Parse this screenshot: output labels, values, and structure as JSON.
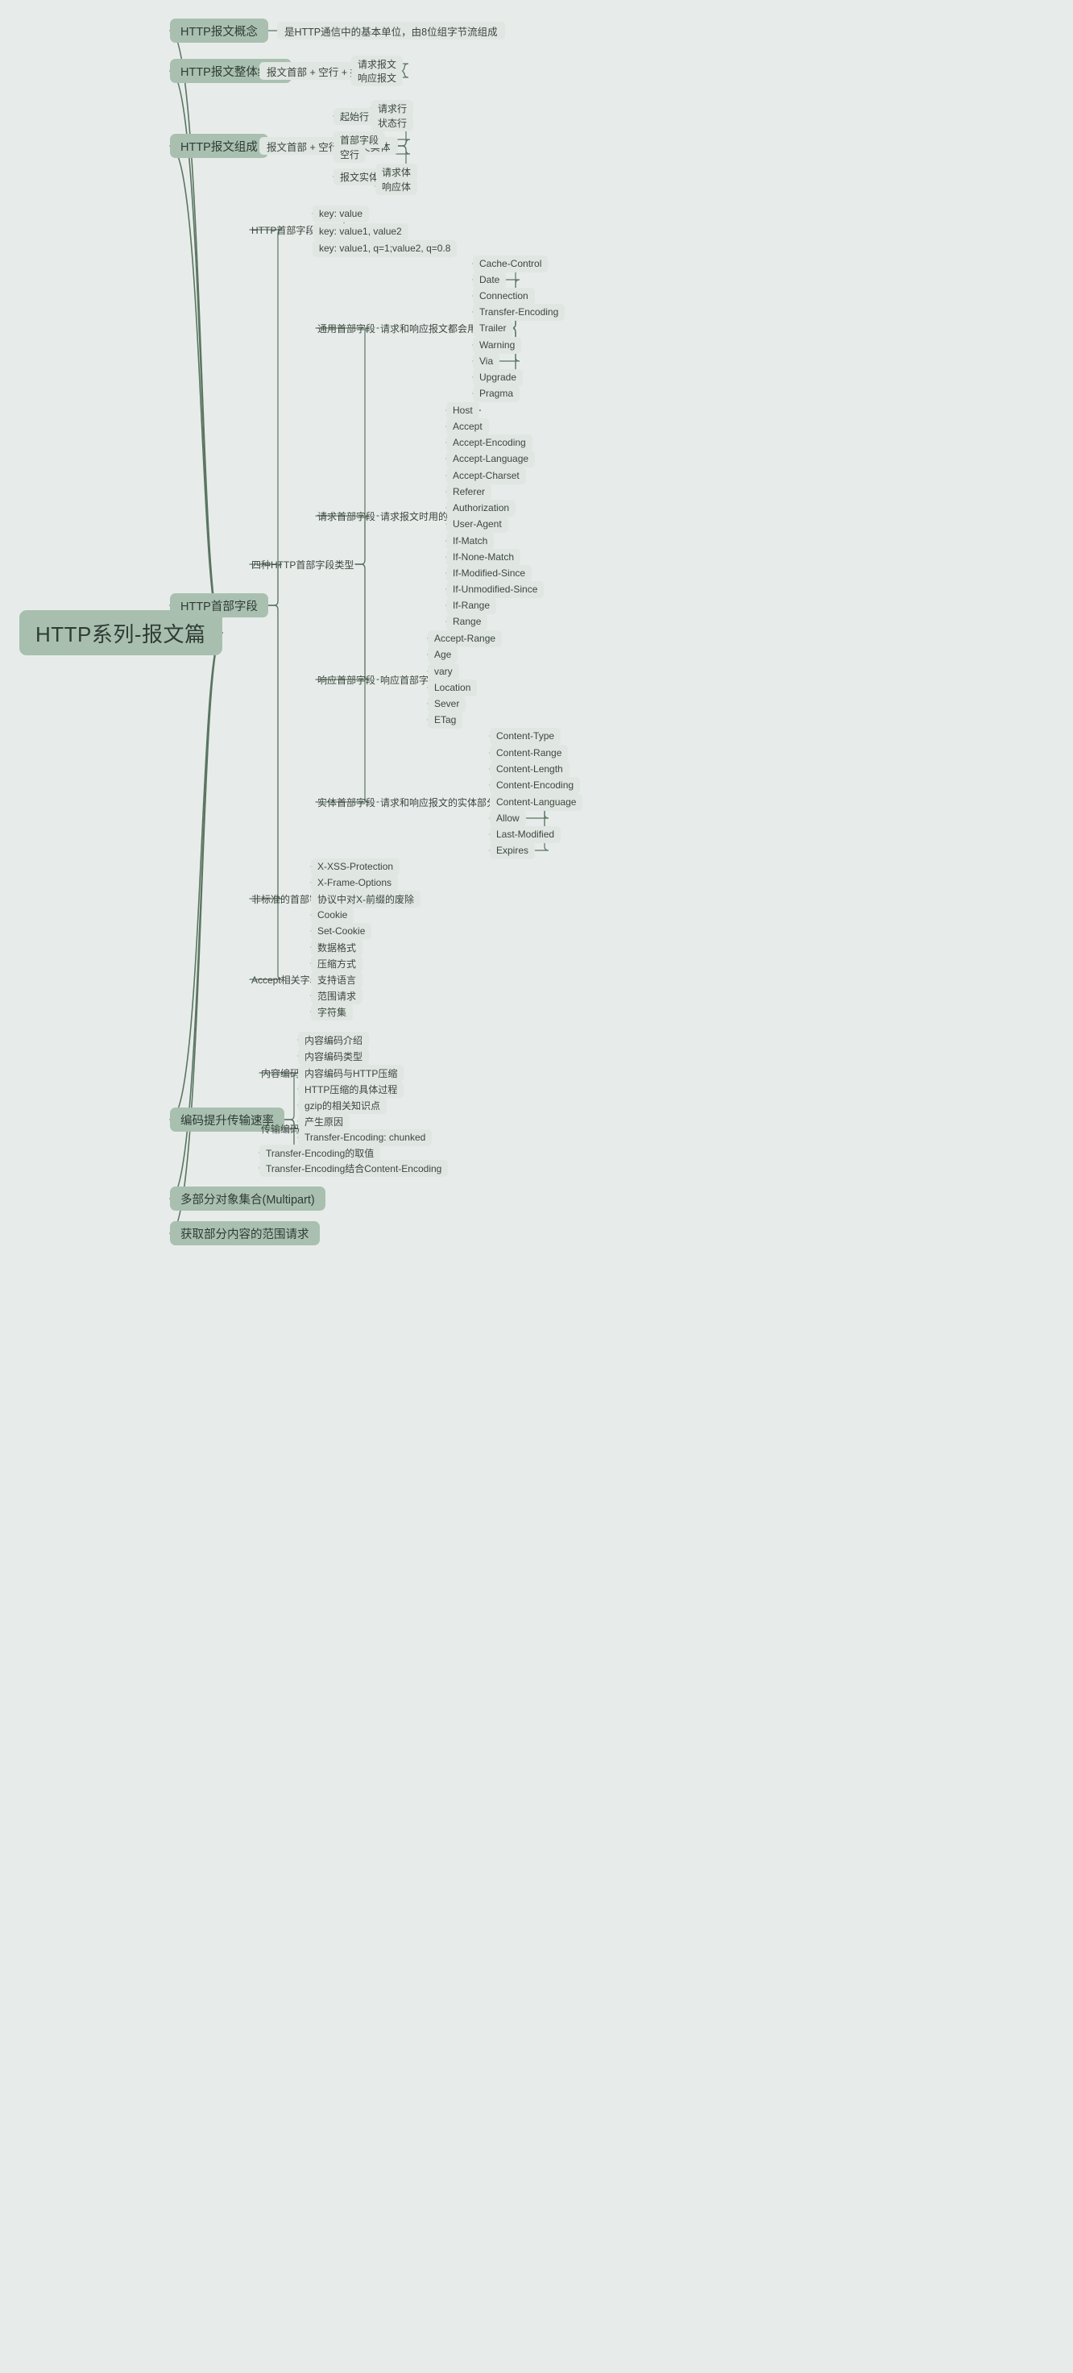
{
  "meta": {
    "title": "HTTP系列-报文篇",
    "colors": {
      "background": "#e7ecea",
      "root_fill": "#a8bfaf",
      "branch_fill": "#a9c0b1",
      "leaf_fill": "#e0e6e2",
      "link": "#5a7561",
      "text": "#3d463f"
    }
  },
  "root": {
    "label": "HTTP系列-报文篇"
  },
  "branches": [
    {
      "label": "HTTP报文概念",
      "children": [
        {
          "label": "是HTTP通信中的基本单位，由8位组字节流组成"
        }
      ]
    },
    {
      "label": "HTTP报文整体结构",
      "children": [
        {
          "label": "报文首部 + 空行 + 报文实体",
          "children": [
            {
              "label": "请求报文"
            },
            {
              "label": "响应报文"
            }
          ]
        }
      ]
    },
    {
      "label": "HTTP报文组成",
      "children": [
        {
          "label": "报文首部 + 空行 + 报文实体",
          "children": [
            {
              "label": "起始行",
              "children": [
                {
                  "label": "请求行"
                },
                {
                  "label": "状态行"
                }
              ]
            },
            {
              "label": "首部字段"
            },
            {
              "label": "空行"
            },
            {
              "label": "报文实体",
              "children": [
                {
                  "label": "请求体"
                },
                {
                  "label": "响应体"
                }
              ]
            }
          ]
        }
      ]
    },
    {
      "label": "HTTP首部字段",
      "children": [
        {
          "label": "HTTP首部字段结构",
          "children": [
            {
              "label": "key: value"
            },
            {
              "label": "key: value1, value2"
            },
            {
              "label": "key: value1, q=1;value2, q=0.8"
            }
          ]
        },
        {
          "label": "四种HTTP首部字段类型",
          "children": [
            {
              "label": "通用首部字段",
              "note": "请求和响应报文都会用的字段",
              "children": [
                {
                  "label": "Cache-Control"
                },
                {
                  "label": "Date"
                },
                {
                  "label": "Connection"
                },
                {
                  "label": "Transfer-Encoding"
                },
                {
                  "label": "Trailer"
                },
                {
                  "label": "Warning"
                },
                {
                  "label": "Via"
                },
                {
                  "label": "Upgrade"
                },
                {
                  "label": "Pragma"
                }
              ]
            },
            {
              "label": "请求首部字段",
              "note": "请求报文时用的字段",
              "children": [
                {
                  "label": "Host"
                },
                {
                  "label": "Accept"
                },
                {
                  "label": "Accept-Encoding"
                },
                {
                  "label": "Accept-Language"
                },
                {
                  "label": "Accept-Charset"
                },
                {
                  "label": "Referer"
                },
                {
                  "label": "Authorization"
                },
                {
                  "label": "User-Agent"
                },
                {
                  "label": "If-Match"
                },
                {
                  "label": "If-None-Match"
                },
                {
                  "label": "If-Modified-Since"
                },
                {
                  "label": "If-Unmodified-Since"
                },
                {
                  "label": "If-Range"
                },
                {
                  "label": "Range"
                }
              ]
            },
            {
              "label": "响应首部字段",
              "note": "响应首部字段",
              "children": [
                {
                  "label": "Accept-Range"
                },
                {
                  "label": "Age"
                },
                {
                  "label": "vary"
                },
                {
                  "label": "Location"
                },
                {
                  "label": "Sever"
                },
                {
                  "label": "ETag"
                }
              ]
            },
            {
              "label": "实体首部字段",
              "note": "请求和响应报文的实体部分用的字段",
              "children": [
                {
                  "label": "Content-Type"
                },
                {
                  "label": "Content-Range"
                },
                {
                  "label": "Content-Length"
                },
                {
                  "label": "Content-Encoding"
                },
                {
                  "label": "Content-Language"
                },
                {
                  "label": "Allow"
                },
                {
                  "label": "Last-Modified"
                },
                {
                  "label": "Expires"
                }
              ]
            }
          ]
        },
        {
          "label": "非标准的首部字段",
          "children": [
            {
              "label": "X-XSS-Protection"
            },
            {
              "label": "X-Frame-Options"
            },
            {
              "label": "协议中对X-前缀的废除"
            },
            {
              "label": "Cookie"
            },
            {
              "label": "Set-Cookie"
            }
          ]
        },
        {
          "label": "Accept相关字段",
          "children": [
            {
              "label": "数据格式"
            },
            {
              "label": "压缩方式"
            },
            {
              "label": "支持语言"
            },
            {
              "label": "范围请求"
            },
            {
              "label": "字符集"
            }
          ]
        }
      ]
    },
    {
      "label": "编码提升传输速率",
      "children": [
        {
          "label": "内容编码",
          "children": [
            {
              "label": "内容编码介绍"
            },
            {
              "label": "内容编码类型"
            },
            {
              "label": "内容编码与HTTP压缩"
            },
            {
              "label": "HTTP压缩的具体过程"
            },
            {
              "label": "gzip的相关知识点"
            }
          ]
        },
        {
          "label": "传输编码",
          "children": [
            {
              "label": "产生原因"
            },
            {
              "label": "Transfer-Encoding: chunked"
            }
          ]
        },
        {
          "label": "Transfer-Encoding的取值"
        },
        {
          "label": "Transfer-Encoding结合Content-Encoding"
        }
      ]
    },
    {
      "label": "多部分对象集合(Multipart)",
      "children": []
    },
    {
      "label": "获取部分内容的范围请求",
      "children": []
    }
  ]
}
